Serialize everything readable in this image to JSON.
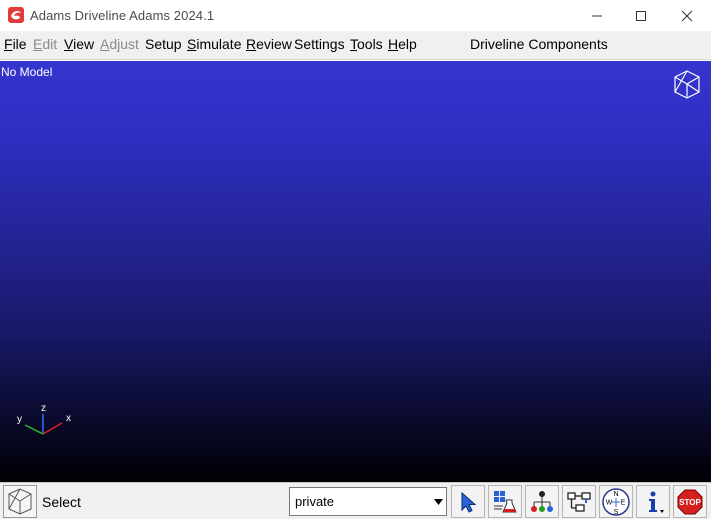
{
  "window": {
    "title": "Adams Driveline Adams 2024.1",
    "app_icon": "adams-logo-icon",
    "controls": [
      "minimize-icon",
      "maximize-icon",
      "close-icon"
    ]
  },
  "menubar": {
    "items": [
      {
        "label": "File",
        "mnemonic": "F",
        "rest": "ile",
        "enabled": true
      },
      {
        "label": "Edit",
        "mnemonic": "E",
        "rest": "dit",
        "enabled": false
      },
      {
        "label": "View",
        "mnemonic": "V",
        "rest": "iew",
        "enabled": true
      },
      {
        "label": "Adjust",
        "mnemonic": "A",
        "rest": "djust",
        "enabled": false
      },
      {
        "label": "Setup",
        "mnemonic": "",
        "rest": "Setup",
        "enabled": true
      },
      {
        "label": "Simulate",
        "mnemonic": "S",
        "rest": "imulate",
        "enabled": true
      },
      {
        "label": "Review",
        "mnemonic": "R",
        "rest": "eview",
        "enabled": true
      },
      {
        "label": "Settings",
        "mnemonic": "",
        "rest": "Settings",
        "enabled": true
      },
      {
        "label": "Tools",
        "mnemonic": "T",
        "rest": "ools",
        "enabled": true
      },
      {
        "label": "Help",
        "mnemonic": "H",
        "rest": "elp",
        "enabled": true
      }
    ],
    "mode_title": "Driveline Components"
  },
  "viewport": {
    "status_text": "No Model",
    "gradient_top": "#3535cf",
    "gradient_bottom": "#000004",
    "triad": {
      "x": "x",
      "y": "y",
      "z": "z"
    }
  },
  "statusbar": {
    "label": "Select",
    "database": {
      "value": "private"
    },
    "tools": [
      "select-arrow-icon",
      "database-navigator-icon",
      "model-hierarchy-icon",
      "browser-tree-icon",
      "view-orientation-compass-icon",
      "information-icon",
      "stop-icon"
    ],
    "compass_letters": {
      "n": "N",
      "s": "S",
      "e": "E",
      "w": "W"
    },
    "stop_label": "STOP"
  },
  "colors": {
    "accent_red": "#e23b3b",
    "stop_red": "#d62020",
    "menu_bg": "#f0f0f0",
    "disabled_text": "#8a8a8a"
  }
}
